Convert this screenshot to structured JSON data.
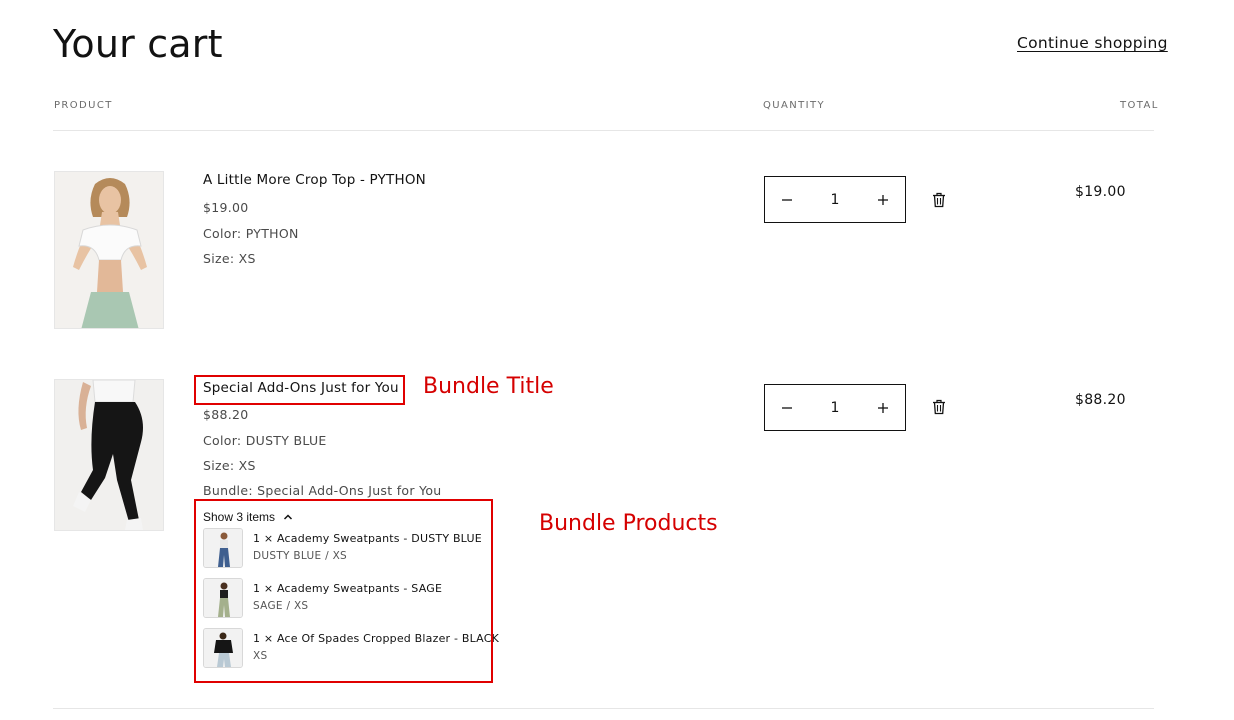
{
  "header": {
    "title": "Your cart",
    "continue_label": "Continue shopping"
  },
  "columns": {
    "product": "PRODUCT",
    "quantity": "QUANTITY",
    "total": "TOTAL"
  },
  "items": [
    {
      "title": "A Little More Crop Top - PYTHON",
      "price": "$19.00",
      "color": "Color: PYTHON",
      "size": "Size: XS",
      "quantity": "1",
      "total": "$19.00"
    },
    {
      "title": "Special Add-Ons Just for You",
      "price": "$88.20",
      "color": "Color: DUSTY BLUE",
      "size": "Size: XS",
      "bundle": "Bundle: Special Add-Ons Just for You",
      "quantity": "1",
      "total": "$88.20",
      "bundle_toggle": "Show 3 items",
      "bundle_products": [
        {
          "name": "1 × Academy Sweatpants - DUSTY BLUE",
          "variant": "DUSTY BLUE / XS"
        },
        {
          "name": "1 × Academy Sweatpants - SAGE",
          "variant": "SAGE / XS"
        },
        {
          "name": "1 × Ace Of Spades Cropped Blazer - BLACK",
          "variant": "XS"
        }
      ]
    }
  ],
  "annotations": {
    "bundle_title": "Bundle Title",
    "bundle_products": "Bundle Products",
    "color": "#e00000"
  },
  "icons": {
    "minus": "minus-icon",
    "plus": "plus-icon",
    "trash": "trash-icon",
    "chevron": "chevron-up-icon"
  }
}
